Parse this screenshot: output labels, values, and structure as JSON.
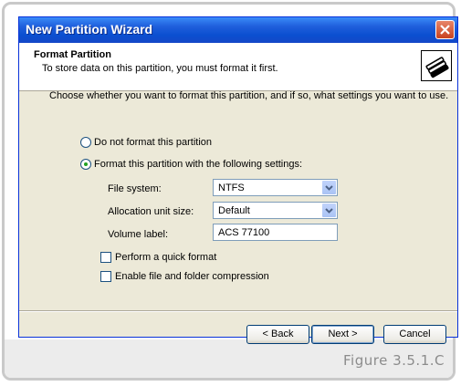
{
  "window": {
    "title": "New Partition Wizard"
  },
  "header": {
    "title": "Format Partition",
    "subtitle": "To store data on this partition, you must format it first."
  },
  "instructions": "Choose whether you want to format this partition, and if so, what settings you want to use.",
  "options": {
    "no_format": {
      "label": "Do not format this partition",
      "selected": false
    },
    "format": {
      "label": "Format this partition with the following settings:",
      "selected": true
    }
  },
  "settings": {
    "file_system_label": "File system:",
    "file_system_value": "NTFS",
    "allocation_label": "Allocation unit size:",
    "allocation_value": "Default",
    "volume_label_label": "Volume label:",
    "volume_label_value": "ACS 77100"
  },
  "checkboxes": {
    "quick_format": {
      "label": "Perform a quick format",
      "checked": false
    },
    "compression": {
      "label": "Enable file and folder compression",
      "checked": false
    }
  },
  "buttons": {
    "back": "< Back",
    "next": "Next >",
    "cancel": "Cancel"
  },
  "caption": "Figure 3.5.1.C",
  "colors": {
    "titlebar": "#0b4fd0",
    "dialog_bg": "#ece9d8",
    "close_button": "#c8421f",
    "radio_dot": "#21a121"
  }
}
